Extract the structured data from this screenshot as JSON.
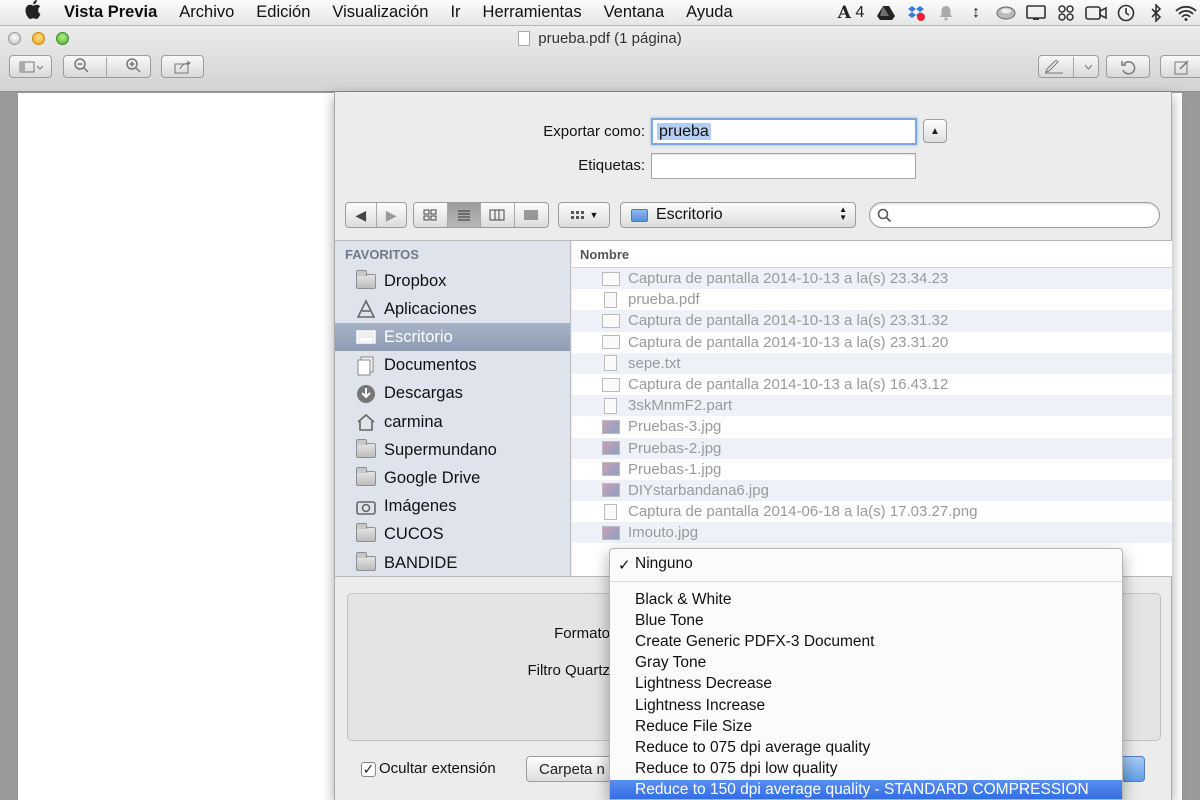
{
  "menubar": {
    "app_name": "Vista Previa",
    "items": [
      "Archivo",
      "Edición",
      "Visualización",
      "Ir",
      "Herramientas",
      "Ventana",
      "Ayuda"
    ],
    "tray_adobe_count": "4"
  },
  "window": {
    "title": "prueba.pdf (1 página)"
  },
  "export": {
    "save_as_label": "Exportar como:",
    "save_as_value": "prueba",
    "tags_label": "Etiquetas:",
    "tags_value": ""
  },
  "location": {
    "current": "Escritorio"
  },
  "sidebar": {
    "heading": "FAVORITOS",
    "items": [
      {
        "label": "Dropbox",
        "icon": "folder-icon"
      },
      {
        "label": "Aplicaciones",
        "icon": "applications-icon"
      },
      {
        "label": "Escritorio",
        "icon": "desktop-icon",
        "selected": true
      },
      {
        "label": "Documentos",
        "icon": "documents-icon"
      },
      {
        "label": "Descargas",
        "icon": "downloads-icon"
      },
      {
        "label": "carmina",
        "icon": "home-icon"
      },
      {
        "label": "Supermundano",
        "icon": "folder-icon"
      },
      {
        "label": "Google Drive",
        "icon": "folder-icon"
      },
      {
        "label": "Imágenes",
        "icon": "camera-icon"
      },
      {
        "label": "CUCOS",
        "icon": "folder-icon"
      },
      {
        "label": "BANDIDE",
        "icon": "folder-icon"
      }
    ]
  },
  "files": {
    "column_header": "Nombre",
    "rows": [
      "Captura de pantalla 2014-10-13 a la(s) 23.34.23",
      "prueba.pdf",
      "Captura de pantalla 2014-10-13 a la(s) 23.31.32",
      "Captura de pantalla 2014-10-13 a la(s) 23.31.20",
      "sepe.txt",
      "Captura de pantalla 2014-10-13 a la(s) 16.43.12",
      "3skMnmF2.part",
      "Pruebas-3.jpg",
      "Pruebas-2.jpg",
      "Pruebas-1.jpg",
      "DIYstarbandana6.jpg",
      "Captura de pantalla 2014-06-18 a la(s) 17.03.27.png",
      "Imouto.jpg"
    ]
  },
  "options": {
    "format_label": "Formato",
    "quartz_filter_label": "Filtro Quartz",
    "hide_extension_label": "Ocultar extensión",
    "hide_extension_checked": true,
    "new_folder_label": "Carpeta n"
  },
  "filter_menu": {
    "selected": "Ninguno",
    "items": [
      "Black & White",
      "Blue Tone",
      "Create Generic PDFX-3 Document",
      "Gray Tone",
      "Lightness Decrease",
      "Lightness Increase",
      "Reduce File Size",
      "Reduce to 075 dpi average quality",
      "Reduce to 075 dpi low quality",
      "Reduce to 150 dpi average quality - STANDARD COMPRESSION"
    ],
    "highlighted": "Reduce to 150 dpi average quality - STANDARD COMPRESSION"
  },
  "colors": {
    "accent": "#2d6ae3",
    "sidebar_bg": "#dfe4ec",
    "sidebar_selected": "#8e9cb4"
  }
}
